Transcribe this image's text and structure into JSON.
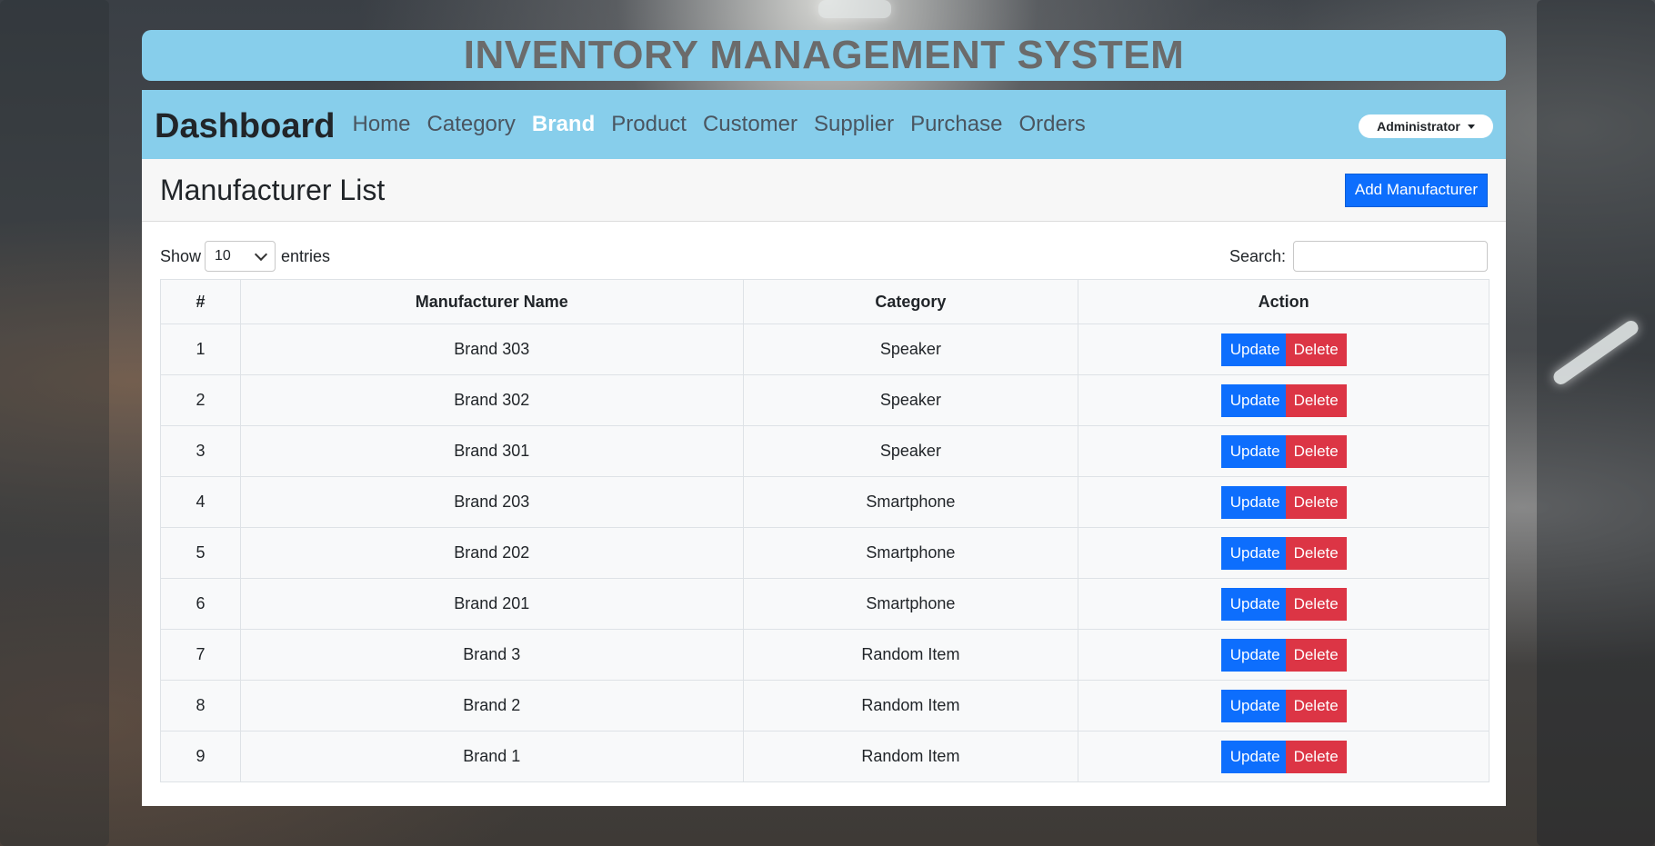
{
  "app": {
    "title": "INVENTORY MANAGEMENT SYSTEM"
  },
  "navbar": {
    "brand": "Dashboard",
    "links": [
      {
        "label": "Home",
        "active": false
      },
      {
        "label": "Category",
        "active": false
      },
      {
        "label": "Brand",
        "active": true
      },
      {
        "label": "Product",
        "active": false
      },
      {
        "label": "Customer",
        "active": false
      },
      {
        "label": "Supplier",
        "active": false
      },
      {
        "label": "Purchase",
        "active": false
      },
      {
        "label": "Orders",
        "active": false
      }
    ],
    "user_menu_label": "Administrator"
  },
  "page": {
    "heading": "Manufacturer List",
    "add_button_label": "Add Manufacturer"
  },
  "controls": {
    "show_label": "Show",
    "entries_value": "10",
    "entries_label": "entries",
    "search_label": "Search:",
    "search_value": ""
  },
  "table": {
    "columns": [
      "#",
      "Manufacturer Name",
      "Category",
      "Action"
    ],
    "update_label": "Update",
    "delete_label": "Delete",
    "rows": [
      {
        "index": "1",
        "name": "Brand 303",
        "category": "Speaker"
      },
      {
        "index": "2",
        "name": "Brand 302",
        "category": "Speaker"
      },
      {
        "index": "3",
        "name": "Brand 301",
        "category": "Speaker"
      },
      {
        "index": "4",
        "name": "Brand 203",
        "category": "Smartphone"
      },
      {
        "index": "5",
        "name": "Brand 202",
        "category": "Smartphone"
      },
      {
        "index": "6",
        "name": "Brand 201",
        "category": "Smartphone"
      },
      {
        "index": "7",
        "name": "Brand 3",
        "category": "Random Item"
      },
      {
        "index": "8",
        "name": "Brand 2",
        "category": "Random Item"
      },
      {
        "index": "9",
        "name": "Brand 1",
        "category": "Random Item"
      }
    ]
  },
  "colors": {
    "header_bg": "#87ceeb",
    "title_text": "#6b6b6b",
    "primary": "#0d6efd",
    "danger": "#dc3545"
  }
}
